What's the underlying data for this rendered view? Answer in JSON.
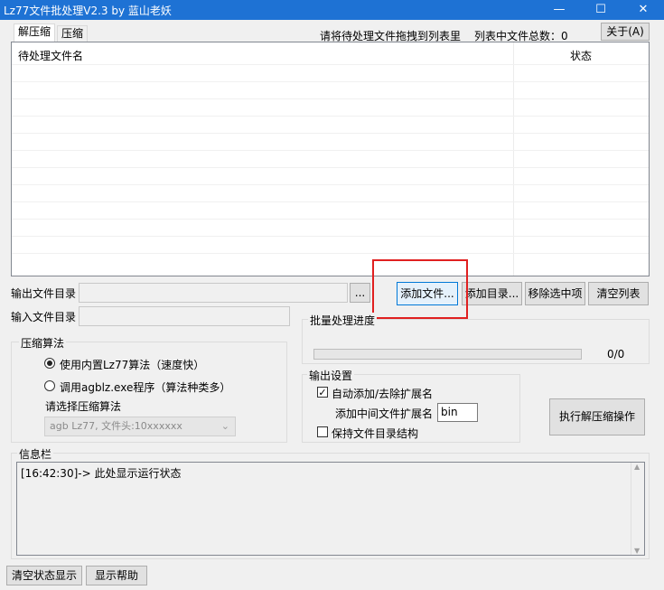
{
  "window": {
    "title": "Lz77文件批处理V2.3 by 蓝山老妖",
    "minimize": "—",
    "maximize": "☐",
    "close": "✕"
  },
  "tabs": [
    {
      "label": "解压缩",
      "active": true
    },
    {
      "label": "压缩",
      "active": false
    }
  ],
  "header": {
    "hint": "请将待处理文件拖拽到列表里",
    "count_label": "列表中文件总数：",
    "count_value": "0",
    "about_label": "关于(A)"
  },
  "file_list": {
    "columns": [
      "待处理文件名",
      "状态"
    ],
    "rows": []
  },
  "paths": {
    "output_label": "输出文件目录",
    "output_value": "",
    "browse_label": "...",
    "input_label": "输入文件目录",
    "input_value": ""
  },
  "actions": {
    "add_file": "添加文件...",
    "add_dir": "添加目录...",
    "remove_selected": "移除选中项",
    "clear_list": "清空列表",
    "execute": "执行解压缩操作"
  },
  "algorithm": {
    "group_label": "压缩算法",
    "option_builtin": "使用内置Lz77算法（速度快）",
    "option_external": "调用agblz.exe程序（算法种类多）",
    "select_label": "请选择压缩算法",
    "select_value": "agb Lz77, 文件头:10xxxxxx",
    "selected": "builtin"
  },
  "progress": {
    "group_label": "批量处理进度",
    "value": 0,
    "text": "0/0"
  },
  "output_settings": {
    "group_label": "输出设置",
    "auto_ext_label": "自动添加/去除扩展名",
    "auto_ext_checked": true,
    "mid_ext_label": "添加中间文件扩展名",
    "mid_ext_value": "bin",
    "keep_structure_label": "保持文件目录结构",
    "keep_structure_checked": false
  },
  "info": {
    "group_label": "信息栏",
    "log": "[16:42:30]-> 此处显示运行状态",
    "clear_status": "清空状态显示",
    "show_help": "显示帮助"
  },
  "colors": {
    "titlebar": "#1e72d4",
    "highlight_box": "#e02020",
    "focused_button_border": "#0078d7"
  }
}
